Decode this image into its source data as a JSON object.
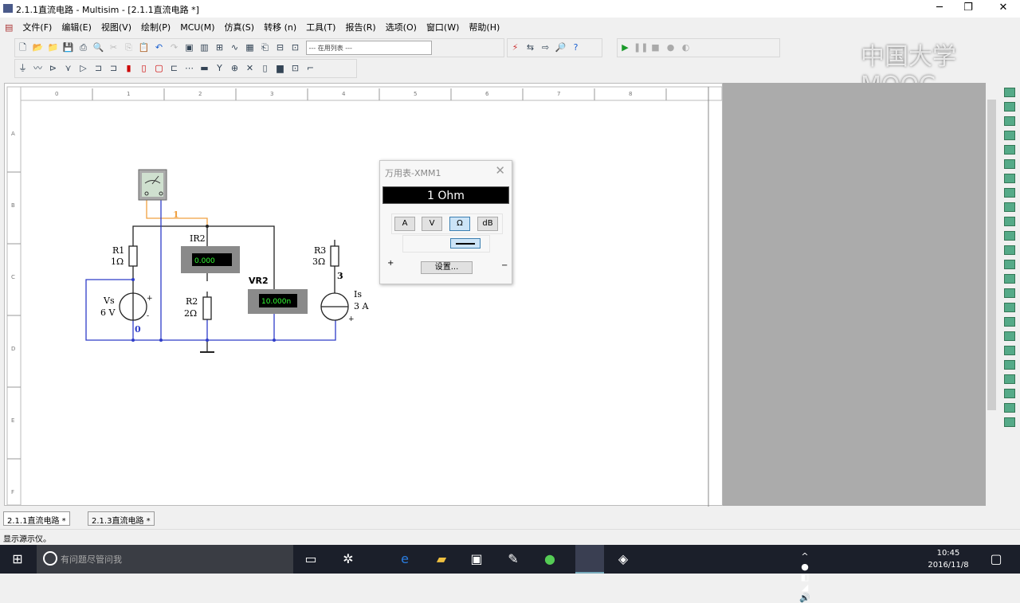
{
  "window": {
    "title": "2.1.1直流电路 - Multisim - [2.1.1直流电路 *]",
    "minimize": "─",
    "maximize": "❐",
    "close": "✕"
  },
  "menu": [
    "文件(F)",
    "编辑(E)",
    "视图(V)",
    "绘制(P)",
    "MCU(M)",
    "仿真(S)",
    "转移 (n)",
    "工具(T)",
    "报告(R)",
    "选项(O)",
    "窗口(W)",
    "帮助(H)"
  ],
  "toolbar": {
    "in_use_list": "--- 在用列表 ---"
  },
  "watermark": "中国大学MOOC",
  "ruler": {
    "columns": [
      "0",
      "1",
      "2",
      "3",
      "4",
      "5",
      "6",
      "7",
      "8"
    ],
    "rows": [
      "A",
      "B",
      "C",
      "D",
      "E",
      "F"
    ]
  },
  "circuit": {
    "net1": "1",
    "net0": "0",
    "net3": "3",
    "r1": {
      "name": "R1",
      "value": "1Ω"
    },
    "r2": {
      "name": "R2",
      "value": "2Ω"
    },
    "r3": {
      "name": "R3",
      "value": "3Ω"
    },
    "vs": {
      "name": "Vs",
      "value": "6 V"
    },
    "is": {
      "name": "Is",
      "value": "3 A"
    },
    "ir2": {
      "name": "IR2",
      "reading": "0.000"
    },
    "vr2": {
      "name": "VR2",
      "reading": "10.000n"
    },
    "plus": "+",
    "minus": "-"
  },
  "multimeter": {
    "title": "万用表-XMM1",
    "display": "1 Ohm",
    "modes": [
      "A",
      "V",
      "Ω",
      "dB"
    ],
    "selected_mode": "Ω",
    "settings": "设置...",
    "plus": "+",
    "minus": "−"
  },
  "tabs": [
    "2.1.1直流电路 *",
    "2.1.3直流电路 *"
  ],
  "status": "显示源示仪。",
  "taskbar": {
    "search_placeholder": "有问题尽管问我",
    "time": "10:45",
    "date": "2016/11/8"
  }
}
